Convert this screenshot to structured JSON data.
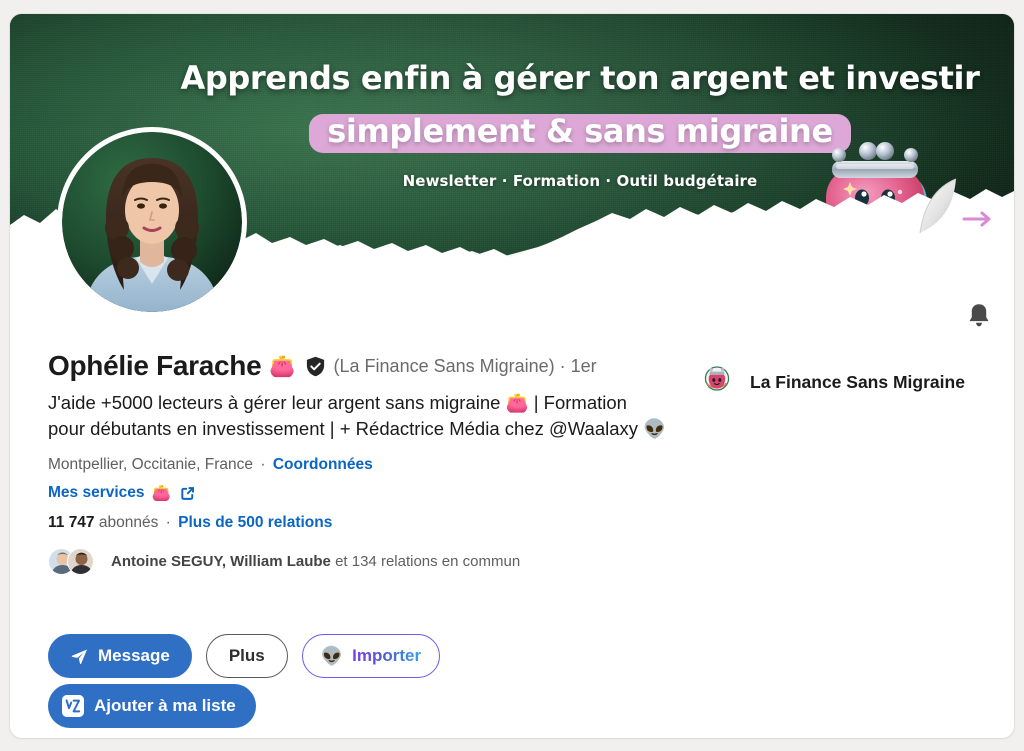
{
  "cover": {
    "headline_line1": "Apprends enfin à gérer ton argent et investir",
    "headline_line2": "simplement & sans migraine",
    "subtitle": "Newsletter · Formation · Outil budgétaire",
    "background_color": "#1c4029",
    "highlight_color": "#dda8d7",
    "purse_icon": "pink-coin-purse-illustration",
    "curl_arrow_color": "#d98ad4"
  },
  "profile": {
    "name": "Ophélie Farache",
    "name_emoji": "👛",
    "verified_badge": "verified-shield-icon",
    "company_parenthetical": "(La Finance Sans Migraine)",
    "degree": "· 1er",
    "headline": "J'aide +5000 lecteurs à gérer leur argent sans migraine 👛 | Formation pour débutants en investissement | + Rédactrice Média chez @Waalaxy 👽",
    "location": "Montpellier, Occitanie, France",
    "location_separator": "·",
    "contact_link": "Coordonnées",
    "services_link": "Mes services",
    "services_emoji": "👛",
    "followers_count": "11 747",
    "followers_label": "abonnés",
    "followers_separator": "·",
    "connections_link": "Plus de 500 relations",
    "mutual_names": "Antoine SEGUY, William Laube",
    "mutual_rest": " et 134 relations en commun",
    "notification_bell": "bell-icon"
  },
  "actions": {
    "message_label": "Message",
    "message_icon": "send-icon",
    "more_label": "Plus",
    "import_label": "Importer",
    "import_icon": "👽",
    "add_to_list_label": "Ajouter à ma liste",
    "add_to_list_icon": "waalaxy-logo-icon",
    "primary_color": "#2f6fc4",
    "import_border_color": "#6a5cf0"
  },
  "company": {
    "name": "La Finance Sans Migraine",
    "logo": "la-finance-sans-migraine-logo"
  }
}
